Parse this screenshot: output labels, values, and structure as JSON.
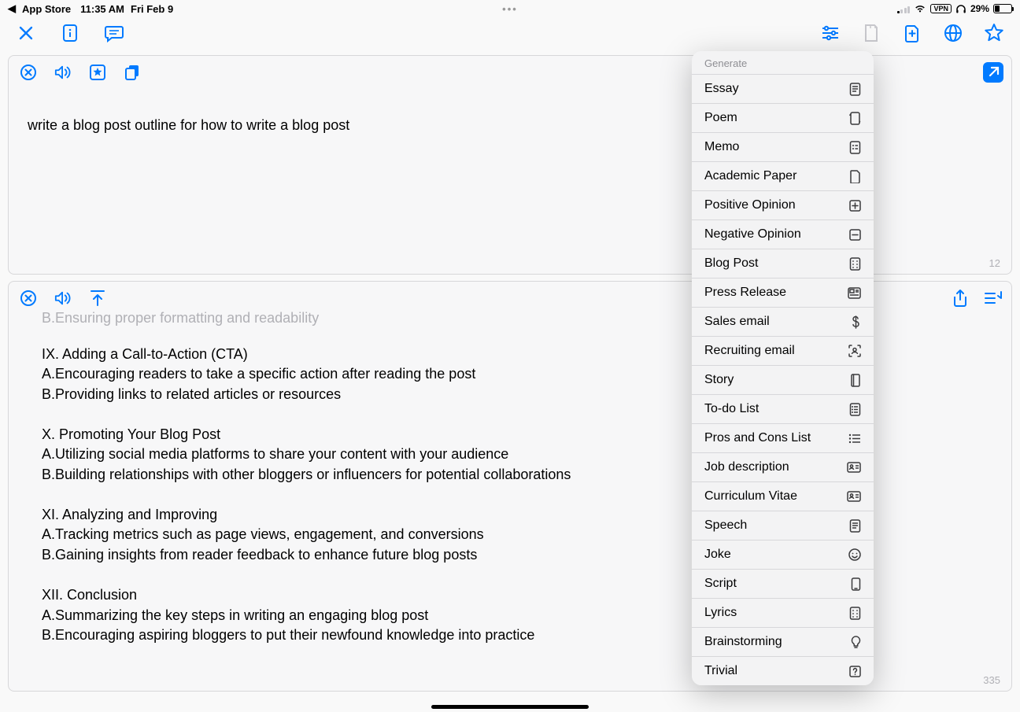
{
  "status": {
    "back_app": "App Store",
    "time": "11:35 AM",
    "date": "Fri Feb 9",
    "vpn_label": "VPN",
    "battery_pct": "29%"
  },
  "panel_top": {
    "prompt": "write a blog post outline for how to write a blog post",
    "word_count": "12"
  },
  "panel_bottom": {
    "cutoff_line": "B.Ensuring proper formatting and readability",
    "content": "IX. Adding a Call-to-Action (CTA)\nA.Encouraging readers to take a specific action after reading the post\nB.Providing links to related articles or resources\n\nX. Promoting Your Blog Post\nA.Utilizing social media platforms to share your content with your audience\nB.Building relationships with other bloggers or influencers for potential collaborations\n\nXI. Analyzing and Improving\nA.Tracking metrics such as page views, engagement, and conversions\nB.Gaining insights from reader feedback to enhance future blog posts\n\nXII. Conclusion\nA.Summarizing the key steps in writing an engaging blog post\nB.Encouraging aspiring bloggers to put their newfound knowledge into practice",
    "word_count": "335"
  },
  "dropdown": {
    "header": "Generate",
    "items": [
      {
        "label": "Essay",
        "icon": "doc-text"
      },
      {
        "label": "Poem",
        "icon": "scroll"
      },
      {
        "label": "Memo",
        "icon": "note"
      },
      {
        "label": "Academic Paper",
        "icon": "doc"
      },
      {
        "label": "Positive Opinion",
        "icon": "plus-square"
      },
      {
        "label": "Negative Opinion",
        "icon": "minus-square"
      },
      {
        "label": "Blog Post",
        "icon": "grid-doc"
      },
      {
        "label": "Press Release",
        "icon": "newspaper"
      },
      {
        "label": "Sales email",
        "icon": "dollar"
      },
      {
        "label": "Recruiting email",
        "icon": "person-viewfinder"
      },
      {
        "label": "Story",
        "icon": "book"
      },
      {
        "label": "To-do List",
        "icon": "list-doc"
      },
      {
        "label": "Pros and Cons List",
        "icon": "list-bullet"
      },
      {
        "label": "Job description",
        "icon": "id-card"
      },
      {
        "label": "Curriculum Vitae",
        "icon": "id-card"
      },
      {
        "label": "Speech",
        "icon": "doc-text"
      },
      {
        "label": "Joke",
        "icon": "smiley"
      },
      {
        "label": "Script",
        "icon": "device"
      },
      {
        "label": "Lyrics",
        "icon": "grid-doc"
      },
      {
        "label": "Brainstorming",
        "icon": "lightbulb"
      },
      {
        "label": "Trivial",
        "icon": "question-square"
      }
    ]
  }
}
